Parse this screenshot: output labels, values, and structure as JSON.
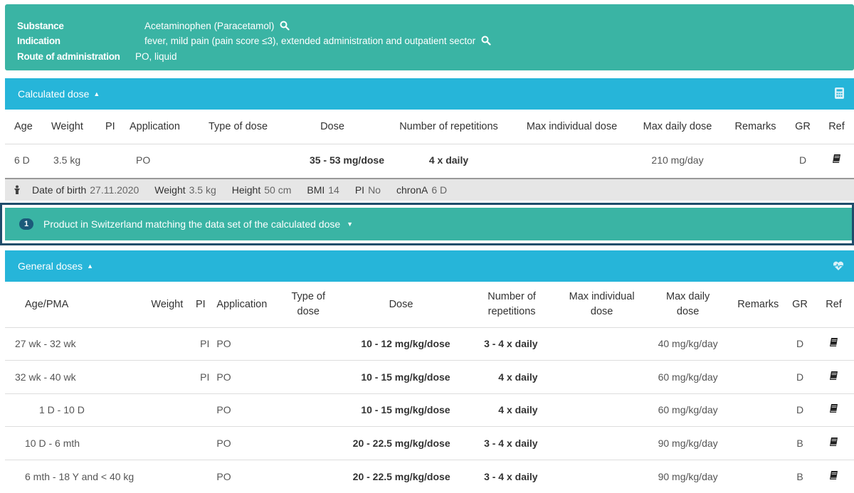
{
  "substance_panel": {
    "substance_label": "Substance",
    "substance_value": "Acetaminophen (Paracetamol)",
    "indication_label": "Indication",
    "indication_value": "fever, mild pain (pain score ≤3), extended administration and outpatient sector",
    "route_label": "Route of administration",
    "route_value": "PO, liquid"
  },
  "calculated": {
    "title": "Calculated dose",
    "columns": [
      "Age",
      "Weight",
      "PI",
      "Application",
      "Type of dose",
      "Dose",
      "Number of repetitions",
      "Max individual dose",
      "Max daily dose",
      "Remarks",
      "GR",
      "Ref"
    ],
    "row": {
      "age": "6 D",
      "weight": "3.5 kg",
      "pi": "",
      "application": "PO",
      "type_of_dose": "",
      "dose": "35 - 53 mg/dose",
      "repetitions": "4 x daily",
      "max_individual": "",
      "max_daily": "210 mg/day",
      "remarks": "",
      "gr": "D"
    }
  },
  "patient": {
    "dob_label": "Date of birth",
    "dob_value": "27.11.2020",
    "weight_label": "Weight",
    "weight_value": "3.5 kg",
    "height_label": "Height",
    "height_value": "50 cm",
    "bmi_label": "BMI",
    "bmi_value": "14",
    "pi_label": "PI",
    "pi_value": "No",
    "chron_label": "chronA",
    "chron_value": "6 D"
  },
  "product": {
    "count": "1",
    "title": "Product in Switzerland matching the data set of the calculated dose"
  },
  "general": {
    "title": "General doses",
    "columns": {
      "age": "Age/PMA",
      "weight": "Weight",
      "pi": "PI",
      "application": "Application",
      "type_of_dose_1": "Type of",
      "type_of_dose_2": "dose",
      "dose": "Dose",
      "repetitions_1": "Number of",
      "repetitions_2": "repetitions",
      "max_individual_1": "Max individual",
      "max_individual_2": "dose",
      "max_daily_1": "Max daily",
      "max_daily_2": "dose",
      "remarks": "Remarks",
      "gr": "GR",
      "ref": "Ref"
    },
    "rows": [
      {
        "age": "27 wk - 32 wk",
        "pi": "PI",
        "application": "PO",
        "dose": "10 - 12 mg/kg/dose",
        "repetitions": "3 - 4 x daily",
        "max_daily": "40 mg/kg/day",
        "gr": "D"
      },
      {
        "age": "32 wk - 40 wk",
        "pi": "PI",
        "application": "PO",
        "dose": "10 - 15 mg/kg/dose",
        "repetitions": "4 x daily",
        "max_daily": "60 mg/kg/day",
        "gr": "D"
      },
      {
        "age": "1 D - 10 D",
        "pi": "",
        "application": "PO",
        "dose": "10 - 15 mg/kg/dose",
        "repetitions": "4 x daily",
        "max_daily": "60 mg/kg/day",
        "gr": "D"
      },
      {
        "age": "10 D - 6 mth",
        "pi": "",
        "application": "PO",
        "dose": "20 - 22.5 mg/kg/dose",
        "repetitions": "3 - 4 x daily",
        "max_daily": "90 mg/kg/day",
        "gr": "B"
      },
      {
        "age": "6 mth - 18 Y and < 40 kg",
        "pi": "",
        "application": "PO",
        "dose": "20 - 22.5 mg/kg/dose",
        "repetitions": "3 - 4 x daily",
        "max_daily": "90 mg/kg/day",
        "gr": "B"
      }
    ]
  },
  "icons": {
    "search": "search-icon",
    "calculator": "calculator-icon",
    "heart": "heartbeat-icon",
    "book": "book-icon",
    "person": "person-icon",
    "caret_up": "caret-up-icon",
    "caret_down": "caret-down-icon"
  }
}
